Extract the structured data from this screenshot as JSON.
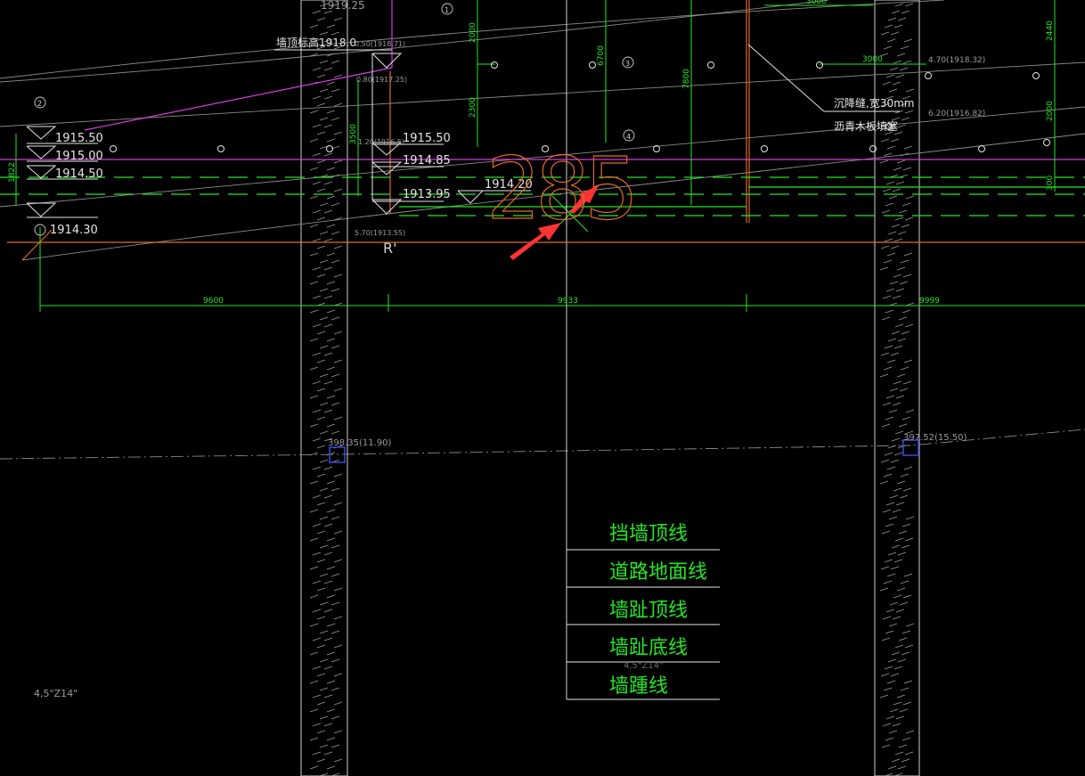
{
  "colors": {
    "background": "#000000",
    "green": "#22e622",
    "white": "#e6e6e6",
    "magenta": "#d63be0",
    "orange": "#e06a2a",
    "red_arrow": "#ff3333",
    "grey": "#8a8a8a",
    "blue_marker": "#3a4bd8"
  },
  "texts": {
    "top_elevation": "1919.25",
    "crest_label": "墙顶标高1918.0",
    "settle_joint": "沉降缝,宽30mm",
    "asphalt_board": "沥青木板填塞",
    "big_number": "285",
    "r_mark": "R'",
    "bottom_left_note": "4,5\"Z14\"",
    "mid_note": "4,5\"Z14\"",
    "marker_left": "398.35(11.90)",
    "marker_right": "397.52(15.50)"
  },
  "small_labels": {
    "a": "0.50(1918.71)",
    "b": "0.80(1917.25)",
    "c": "1.20(1916.5)",
    "d": "5.70(1913.55)",
    "e": "4.70(1918.32)",
    "f": "6.20(1916.82)"
  },
  "elevations_left": [
    "1915.50",
    "1915.00",
    "1914.50",
    "1914.30"
  ],
  "elevations_mid": [
    "1915.50",
    "1914.85",
    "1913.95",
    "1914.20"
  ],
  "vertical_dims": [
    "2000",
    "2300",
    "6700",
    "7800",
    "2440",
    "2000",
    "300",
    "3500",
    "1822"
  ],
  "horizontal_dims": [
    "3000",
    "3000",
    "9600",
    "9933",
    "9999"
  ],
  "circle_markers": [
    "1",
    "2",
    "3",
    "4"
  ],
  "legend": [
    "挡墙顶线",
    "道路地面线",
    "墙趾顶线",
    "墙趾底线",
    "墙踵线"
  ]
}
